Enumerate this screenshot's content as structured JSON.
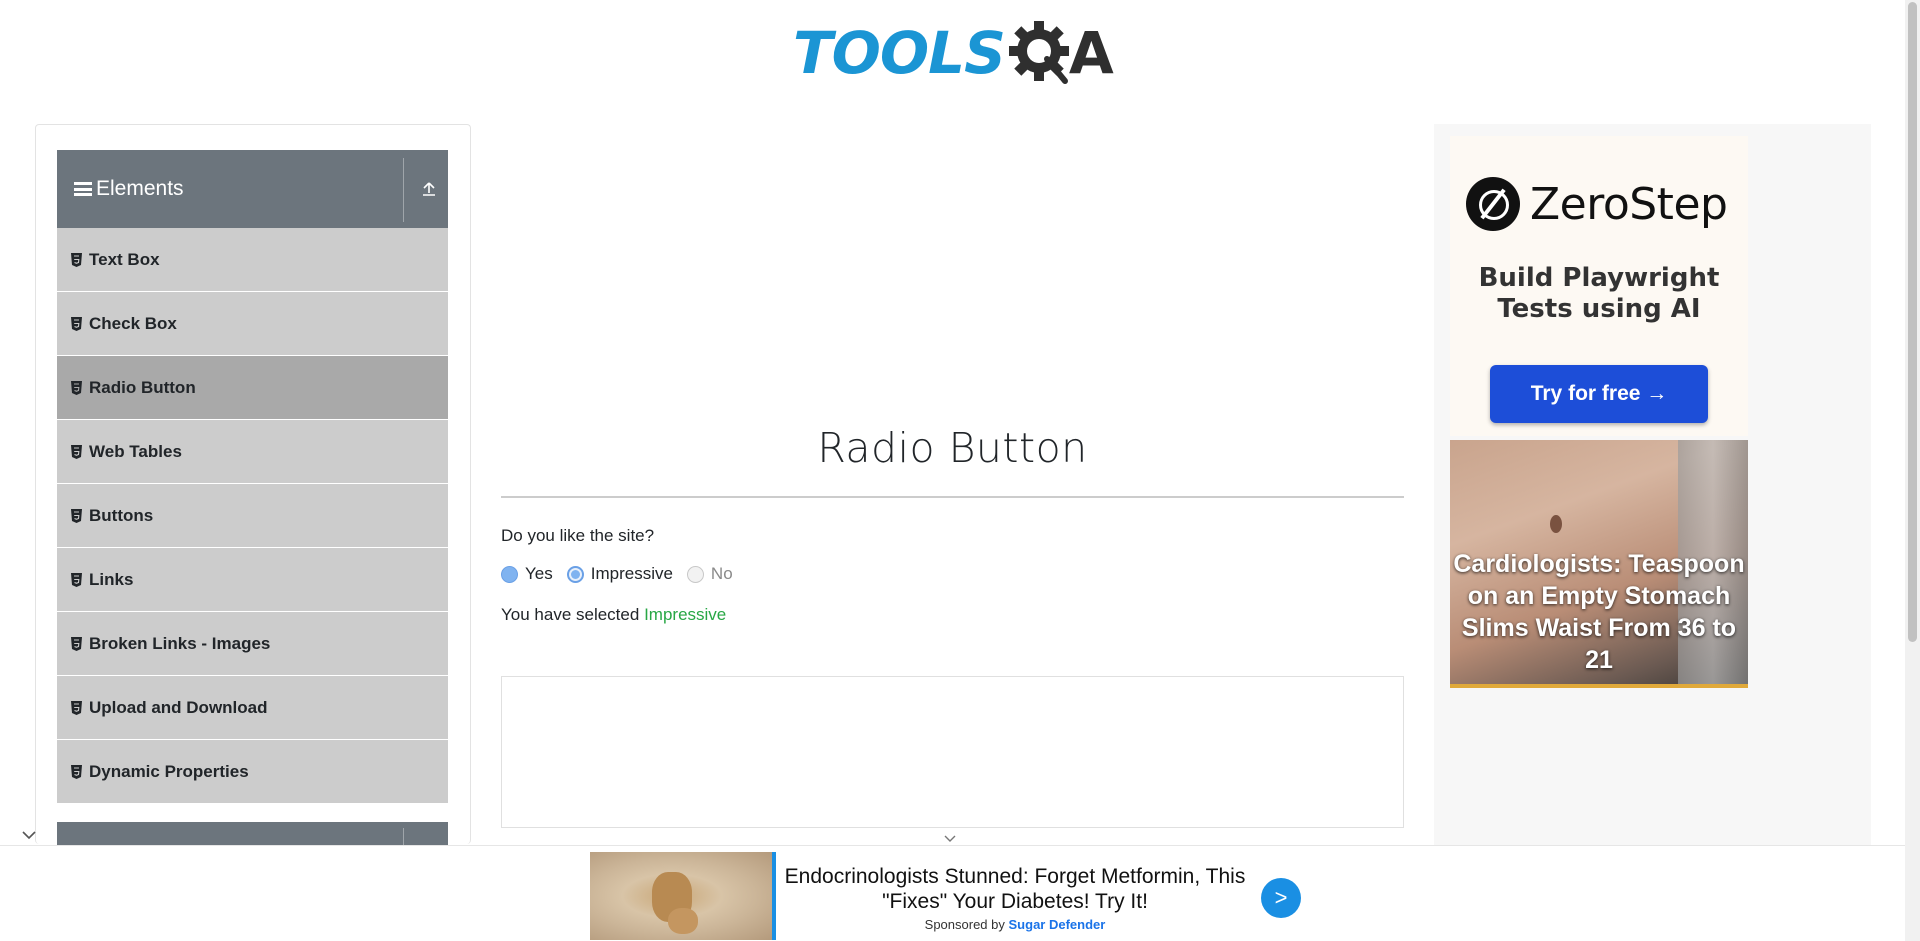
{
  "header": {
    "logo_tools": "TOOLS",
    "logo_qa": "A"
  },
  "sidebar": {
    "group_title": "Elements",
    "items": [
      {
        "label": "Text Box"
      },
      {
        "label": "Check Box"
      },
      {
        "label": "Radio Button",
        "active": true
      },
      {
        "label": "Web Tables"
      },
      {
        "label": "Buttons"
      },
      {
        "label": "Links"
      },
      {
        "label": "Broken Links - Images"
      },
      {
        "label": "Upload and Download"
      },
      {
        "label": "Dynamic Properties"
      }
    ]
  },
  "main": {
    "title": "Radio Button",
    "question": "Do you like the site?",
    "options": [
      {
        "label": "Yes",
        "state": "enabled"
      },
      {
        "label": "Impressive",
        "state": "checked"
      },
      {
        "label": "No",
        "state": "disabled"
      }
    ],
    "result_prefix": "You have selected",
    "result_value": "Impressive"
  },
  "right_ad": {
    "brand": "ZeroStep",
    "tagline_line1": "Build Playwright",
    "tagline_line2": "Tests using AI",
    "cta": "Try for free →",
    "promo_text": "Cardiologists: Teaspoon on an Empty Stomach Slims Waist From 36 to 21"
  },
  "bottom_ad": {
    "headline": "Endocrinologists Stunned: Forget Metformin, This \"Fixes\" Your Diabetes! Try It!",
    "sponsored_prefix": "Sponsored by",
    "sponsor": "Sugar Defender",
    "go_label": ">"
  },
  "colors": {
    "menu_header": "#6c757d",
    "menu_item": "#cccccc",
    "menu_active": "#a9a9a9",
    "result_green": "#28a745",
    "logo_blue": "#1b95d4",
    "cta_blue": "#1d4ed8"
  }
}
